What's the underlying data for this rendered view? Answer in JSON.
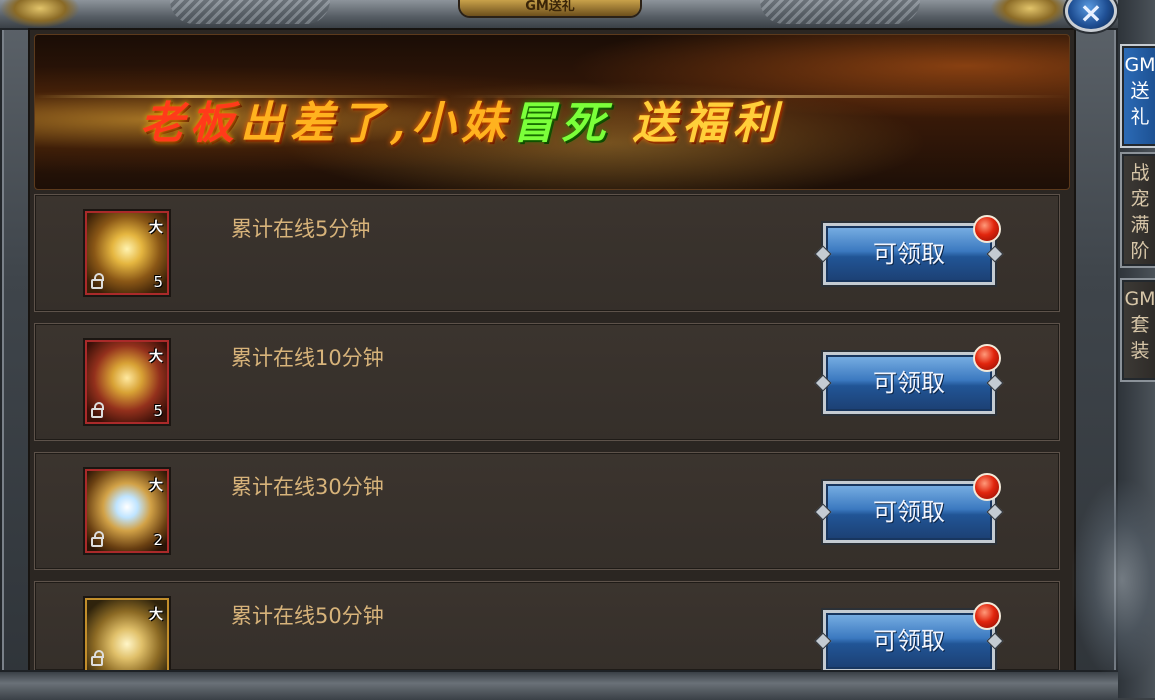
{
  "window": {
    "title": "GM送礼",
    "close_icon": "close-icon"
  },
  "banner": {
    "slogan_parts": [
      "老板",
      "出差了,小妹",
      "冒死",
      "送福利"
    ]
  },
  "rewards": [
    {
      "label": "累计在线5分钟",
      "item_tag": "大",
      "item_count": "5",
      "item_icon": "winged-ring-icon",
      "button": "可领取"
    },
    {
      "label": "累计在线10分钟",
      "item_tag": "大",
      "item_count": "5",
      "item_icon": "flower-necklace-icon",
      "button": "可领取"
    },
    {
      "label": "累计在线30分钟",
      "item_tag": "大",
      "item_count": "2",
      "item_icon": "crystal-gem-icon",
      "button": "可领取"
    },
    {
      "label": "累计在线50分钟",
      "item_tag": "大",
      "item_count": "",
      "item_icon": "treasure-chest-icon",
      "button": "可领取"
    }
  ],
  "side_tabs": [
    {
      "lines": [
        "GM",
        "送",
        "礼"
      ],
      "active": true
    },
    {
      "lines": [
        "战",
        "宠",
        "满",
        "阶"
      ],
      "active": false
    },
    {
      "lines": [
        "GM",
        "套",
        "装"
      ],
      "active": false
    }
  ],
  "colors": {
    "claim_button": "#2f6bb0",
    "notify_dot": "#e1260e",
    "label_text": "#d7b37a"
  }
}
